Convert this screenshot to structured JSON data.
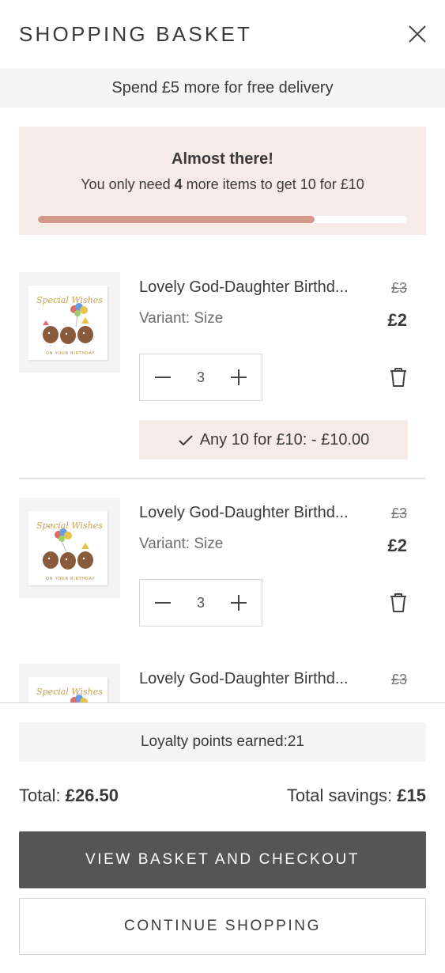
{
  "header": {
    "title": "SHOPPING BASKET",
    "close_icon": "close-icon"
  },
  "delivery": {
    "text": "Spend £5 more for free delivery"
  },
  "promo": {
    "heading": "Almost there!",
    "text_before": "You only need ",
    "count": "4",
    "text_after": " more items to get 10 for £10",
    "progress": 0.75,
    "progress_color": "#d3988a"
  },
  "items": [
    {
      "name": "Lovely God-Daughter Birthd...",
      "old_price": "£3",
      "variant": "Variant: Size",
      "price": "£2",
      "quantity": "3",
      "discount": "Any 10 for £10: - £10.00"
    },
    {
      "name": "Lovely God-Daughter Birthd...",
      "old_price": "£3",
      "variant": "Variant: Size",
      "price": "£2",
      "quantity": "3"
    },
    {
      "name": "Lovely God-Daughter Birthd...",
      "old_price": "£3"
    }
  ],
  "footer": {
    "loyalty": "Loyalty points earned:21",
    "total_label": "Total: ",
    "total_value": "£26.50",
    "savings_label": "Total savings: ",
    "savings_value": "£15",
    "checkout_label": "VIEW BASKET AND CHECKOUT",
    "continue_label": "CONTINUE SHOPPING"
  },
  "colors": {
    "accent_bg": "#f6ebe6",
    "primary_button": "#555555",
    "progress": "#d3988a"
  }
}
